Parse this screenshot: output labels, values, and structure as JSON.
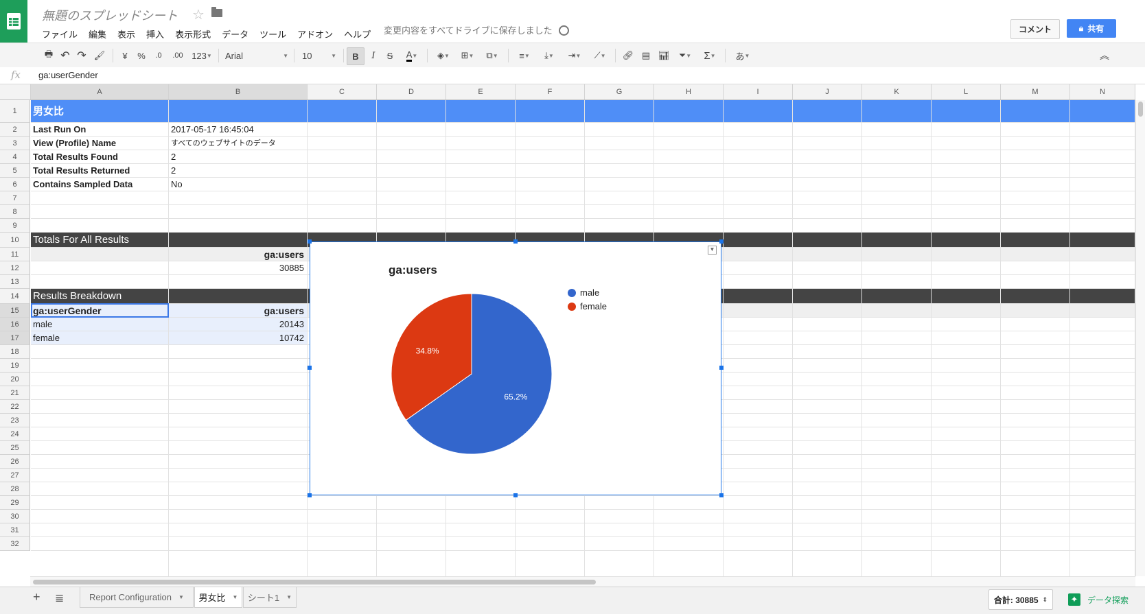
{
  "app": {
    "doc_title": "無題のスプレッドシート",
    "save_status": "変更内容をすべてドライブに保存しました",
    "comment_label": "コメント",
    "share_label": "共有"
  },
  "menu": [
    "ファイル",
    "編集",
    "表示",
    "挿入",
    "表示形式",
    "データ",
    "ツール",
    "アドオン",
    "ヘルプ"
  ],
  "toolbar": {
    "currency": "¥",
    "percent": "%",
    "dec_decrease": ".0",
    "dec_increase": ".00",
    "number_format": "123",
    "font": "Arial",
    "font_size": "10",
    "bold": "B",
    "italic": "I",
    "strike": "S",
    "text_color": "A",
    "input_tools": "あ",
    "sigma": "Σ"
  },
  "formula": {
    "fx": "fx",
    "value": "ga:userGender"
  },
  "columns": [
    "A",
    "B",
    "C",
    "D",
    "E",
    "F",
    "G",
    "H",
    "I",
    "J",
    "K",
    "L",
    "M",
    "N"
  ],
  "rows": [
    "1",
    "2",
    "3",
    "4",
    "5",
    "6",
    "7",
    "8",
    "9",
    "10",
    "11",
    "12",
    "13",
    "14",
    "15",
    "16",
    "17",
    "18",
    "19",
    "20",
    "21",
    "22",
    "23",
    "24",
    "25",
    "26",
    "27",
    "28",
    "29",
    "30",
    "31",
    "32"
  ],
  "sheet": {
    "title": "男女比",
    "info": [
      {
        "label": "Last Run On",
        "value": "2017-05-17 16:45:04"
      },
      {
        "label": "View (Profile) Name",
        "value": "すべてのウェブサイトのデータ"
      },
      {
        "label": "Total Results Found",
        "value": "2"
      },
      {
        "label": "Total Results Returned",
        "value": "2"
      },
      {
        "label": "Contains Sampled Data",
        "value": "No"
      }
    ],
    "totals_header": "Totals For All Results",
    "totals_metric": "ga:users",
    "totals_value": "30885",
    "breakdown_header": "Results Breakdown",
    "breakdown_col1": "ga:userGender",
    "breakdown_col2": "ga:users",
    "breakdown_rows": [
      {
        "dim": "male",
        "val": "20143"
      },
      {
        "dim": "female",
        "val": "10742"
      }
    ]
  },
  "chart_data": {
    "type": "pie",
    "title": "ga:users",
    "categories": [
      "male",
      "female"
    ],
    "values": [
      20143,
      10742
    ],
    "percent_labels": [
      "65.2%",
      "34.8%"
    ],
    "colors": [
      "#3366cc",
      "#dc3912"
    ],
    "legend": "right"
  },
  "tabs": [
    {
      "label": "Report Configuration"
    },
    {
      "label": "男女比"
    },
    {
      "label": "シート1"
    }
  ],
  "status": {
    "sum": "合計: 30885",
    "explore": "データ探索"
  }
}
